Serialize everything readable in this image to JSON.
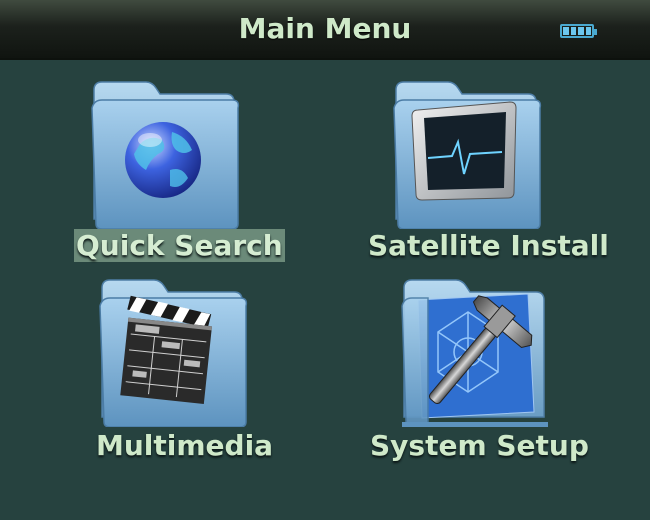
{
  "header": {
    "title": "Main Menu",
    "battery_icon": "battery-icon",
    "battery_level": 1.0
  },
  "menu": {
    "selected_index": 0,
    "items": [
      {
        "label": "Quick Search",
        "icon": "globe-folder-icon"
      },
      {
        "label": "Satellite Install",
        "icon": "monitor-folder-icon"
      },
      {
        "label": "Multimedia",
        "icon": "clapperboard-folder-icon"
      },
      {
        "label": "System Setup",
        "icon": "hammer-folder-icon"
      }
    ]
  },
  "colors": {
    "background": "#26423f",
    "label_text": "#cfe9c9",
    "highlight": "#6b8a79",
    "folder_blue": "#9cc8e6"
  }
}
